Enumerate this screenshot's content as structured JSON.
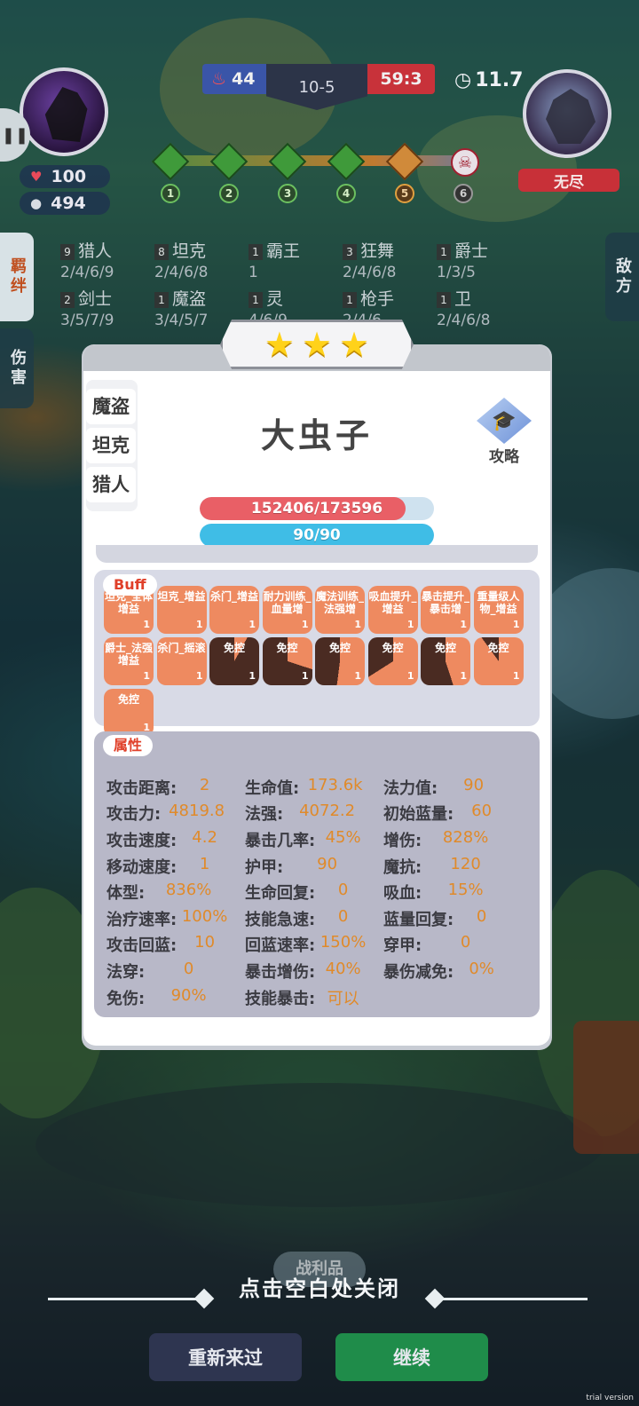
{
  "hud": {
    "player_hp": "100",
    "player_gold": "494",
    "score_left": "44",
    "round": "10-5",
    "score_right": "59:3",
    "timer": "11.7",
    "enemy_name": "无尽",
    "stages": [
      "1",
      "2",
      "3",
      "4",
      "5",
      "6"
    ],
    "current_stage": "5"
  },
  "tabs": {
    "bond": "羁绊",
    "damage": "伤害",
    "enemy": "敌方"
  },
  "bonds": [
    {
      "count": "9",
      "name": "猎人",
      "levels": "2/4/6/9"
    },
    {
      "count": "8",
      "name": "坦克",
      "levels": "2/4/6/8"
    },
    {
      "count": "1",
      "name": "霸王",
      "levels": "1"
    },
    {
      "count": "3",
      "name": "狂舞",
      "levels": "2/4/6/8"
    },
    {
      "count": "1",
      "name": "爵士",
      "levels": "1/3/5"
    },
    {
      "count": "2",
      "name": "剑士",
      "levels": "3/5/7/9"
    },
    {
      "count": "1",
      "name": "魔盗",
      "levels": "3/4/5/7"
    },
    {
      "count": "1",
      "name": "灵",
      "levels": "4/6/9"
    },
    {
      "count": "1",
      "name": "枪手",
      "levels": "2/4/6"
    },
    {
      "count": "1",
      "name": "卫",
      "levels": "2/4/6/8"
    }
  ],
  "unit": {
    "stars": 3,
    "star_glyph": "★",
    "name": "大虫子",
    "tags": [
      "魔盗",
      "坦克",
      "猎人"
    ],
    "guide_label": "攻略",
    "hp_text": "152406/173596",
    "hp_fraction": 0.878,
    "mp_text": "90/90",
    "mp_fraction": 1.0
  },
  "buffs": {
    "label": "Buff",
    "items": [
      {
        "name": "坦克_全体增益",
        "count": "1",
        "remaining": 1.0
      },
      {
        "name": "坦克_增益",
        "count": "1",
        "remaining": 1.0
      },
      {
        "name": "杀门_增益",
        "count": "1",
        "remaining": 1.0
      },
      {
        "name": "耐力训练_血量增",
        "count": "1",
        "remaining": 1.0
      },
      {
        "name": "魔法训练_法强增",
        "count": "1",
        "remaining": 1.0
      },
      {
        "name": "吸血提升_增益",
        "count": "1",
        "remaining": 1.0
      },
      {
        "name": "暴击提升_暴击增",
        "count": "1",
        "remaining": 1.0
      },
      {
        "name": "重量级人物_增益",
        "count": "1",
        "remaining": 1.0
      },
      {
        "name": "爵士_法强增益",
        "count": "1",
        "remaining": 1.0
      },
      {
        "name": "杀门_摇滚",
        "count": "1",
        "remaining": 1.0
      },
      {
        "name": "免控",
        "count": "1",
        "remaining": 0.08
      },
      {
        "name": "免控",
        "count": "1",
        "remaining": 0.3
      },
      {
        "name": "免控",
        "count": "1",
        "remaining": 0.52
      },
      {
        "name": "免控",
        "count": "1",
        "remaining": 0.66
      },
      {
        "name": "免控",
        "count": "1",
        "remaining": 0.45
      },
      {
        "name": "免控",
        "count": "1",
        "remaining": 0.9
      },
      {
        "name": "免控",
        "count": "1",
        "remaining": 1.0
      }
    ]
  },
  "attributes": {
    "label": "属性",
    "rows": [
      [
        {
          "k": "攻击距离:",
          "v": "2"
        },
        {
          "k": "生命值:",
          "v": "173.6k"
        },
        {
          "k": "法力值:",
          "v": "90"
        }
      ],
      [
        {
          "k": "攻击力:",
          "v": "4819.8"
        },
        {
          "k": "法强:",
          "v": "4072.2"
        },
        {
          "k": "初始蓝量:",
          "v": "60"
        }
      ],
      [
        {
          "k": "攻击速度:",
          "v": "4.2"
        },
        {
          "k": "暴击几率:",
          "v": "45%"
        },
        {
          "k": "增伤:",
          "v": "828%"
        }
      ],
      [
        {
          "k": "移动速度:",
          "v": "1"
        },
        {
          "k": "护甲:",
          "v": "90"
        },
        {
          "k": "魔抗:",
          "v": "120"
        }
      ],
      [
        {
          "k": "体型:",
          "v": "836%"
        },
        {
          "k": "生命回复:",
          "v": "0"
        },
        {
          "k": "吸血:",
          "v": "15%"
        }
      ],
      [
        {
          "k": "治疗速率:",
          "v": "100%"
        },
        {
          "k": "技能急速:",
          "v": "0"
        },
        {
          "k": "蓝量回复:",
          "v": "0"
        }
      ],
      [
        {
          "k": "攻击回蓝:",
          "v": "10"
        },
        {
          "k": "回蓝速率:",
          "v": "150%"
        },
        {
          "k": "穿甲:",
          "v": "0"
        }
      ],
      [
        {
          "k": "法穿:",
          "v": "0"
        },
        {
          "k": "暴击增伤:",
          "v": "40%"
        },
        {
          "k": "暴伤减免:",
          "v": "0%"
        }
      ],
      [
        {
          "k": "免伤:",
          "v": "90%"
        },
        {
          "k": "技能暴击:",
          "v": "可以"
        }
      ]
    ]
  },
  "footer": {
    "loot_label": "战利品",
    "close_hint": "点击空白处关闭",
    "restart_label": "重新来过",
    "continue_label": "继续",
    "watermark": "trial version"
  },
  "colors": {
    "hp": "#e95f66",
    "mp": "#3fbde6",
    "buff": "#ee8a60",
    "attr_value": "#e08a2a",
    "continue": "#1f8c4a",
    "restart": "#2e3550"
  }
}
